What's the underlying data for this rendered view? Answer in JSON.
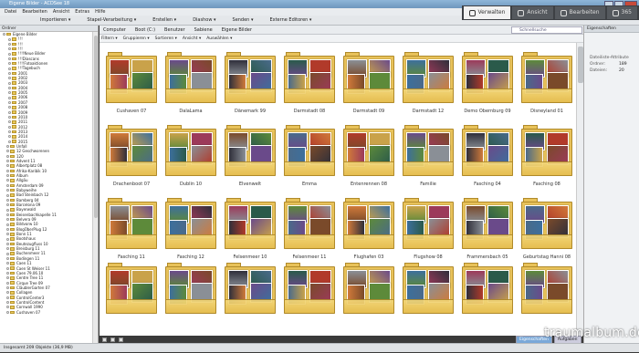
{
  "window": {
    "title": "Eigene Bilder - ACDSee 18"
  },
  "menu": [
    "Datei",
    "Bearbeiten",
    "Ansicht",
    "Extras",
    "Hilfe"
  ],
  "toolbar": [
    "Importieren ▾",
    "Stapel-Verarbeitung ▾",
    "Erstellen ▾",
    "Diashow ▾",
    "Senden ▾",
    "Externe Editoren ▾"
  ],
  "modes": [
    {
      "label": "Verwalten",
      "active": true
    },
    {
      "label": "Ansicht",
      "active": false
    },
    {
      "label": "Bearbeiten",
      "active": false
    },
    {
      "label": "365",
      "active": false
    }
  ],
  "left_panel": {
    "title": "Ordner"
  },
  "tree": [
    "Eigene Bilder",
    "!!!",
    "!!!",
    "!!!",
    "!!!!Neue Bilder",
    "!!!Diascans",
    "!!!!Fotoaktionen",
    "!!!Tagebuch",
    "2001",
    "2002",
    "2003",
    "2004",
    "2005",
    "2006",
    "2007",
    "2008",
    "2009",
    "2010",
    "2011",
    "2012",
    "2013",
    "2014",
    "2015",
    "Unfall",
    "12 Geschworenen",
    "120",
    "Advent 11",
    "Albertplatz 08",
    "Afrika-Karibik 10",
    "Album",
    "Allgäu",
    "Amsterdam 09",
    "Babyweihe",
    "Bad Steinbach 12",
    "Bamberg 04",
    "Barcelona 09",
    "Bayerwald",
    "Beisenbachkapelle 11",
    "Belvera 09",
    "Bildvorw 10",
    "BlogÜberPlug 12",
    "Bonn 11",
    "Bootshaus",
    "Beutezugfluss 10",
    "Breisburg 11",
    "Buchenmeer 11",
    "Bodingen 11",
    "Caen 11",
    "Caen St Weiser 11",
    "Caen 79.06.10",
    "Centre Tree 11",
    "Cirque Tree 09",
    "CläublerGarten 07",
    "Collagen",
    "ControlCenter3",
    "ControlContent",
    "Cornwall 1990",
    "Cushaven 07"
  ],
  "path": [
    "Computer",
    "Boot (C:)",
    "Benutzer",
    "Sabiene",
    "Eigene Bilder"
  ],
  "quicksearch": {
    "placeholder": "Schnellsuche"
  },
  "filters": [
    "Filtern ▾",
    "Gruppieren ▾",
    "Sortieren ▾",
    "Ansicht ▾",
    "Auswählen ▾"
  ],
  "folders": [
    {
      "name": "Cushaven 07"
    },
    {
      "name": "DalaLama"
    },
    {
      "name": "Dänemark 99"
    },
    {
      "name": "Darmstadt 08"
    },
    {
      "name": "Darmstadt 09"
    },
    {
      "name": "Darmstadt 12"
    },
    {
      "name": "Demo Obernburg 09"
    },
    {
      "name": "Disneyland 01"
    },
    {
      "name": "Drachenboot 07"
    },
    {
      "name": "Dublin 10"
    },
    {
      "name": "Elvenwelt"
    },
    {
      "name": "Emma"
    },
    {
      "name": "Entenrennen 08"
    },
    {
      "name": "Familie"
    },
    {
      "name": "Fasching 04"
    },
    {
      "name": "Fasching 08"
    },
    {
      "name": "Fasching 11"
    },
    {
      "name": "Fasching 12"
    },
    {
      "name": "Felsenmeer 10"
    },
    {
      "name": "Felsenmeer 11"
    },
    {
      "name": "Flughafen 03"
    },
    {
      "name": "Flugshow 08"
    },
    {
      "name": "Frammersbach 05"
    },
    {
      "name": "Geburtstag Hanni 08"
    },
    {
      "name": ""
    },
    {
      "name": ""
    },
    {
      "name": ""
    },
    {
      "name": ""
    },
    {
      "name": ""
    },
    {
      "name": ""
    },
    {
      "name": ""
    },
    {
      "name": ""
    }
  ],
  "properties": {
    "title": "Eigenschaften",
    "section": "Dateiliste-Attribute",
    "rows": [
      {
        "k": "Ordner:",
        "v": "189"
      },
      {
        "k": "Dateien:",
        "v": "20"
      }
    ]
  },
  "status": {
    "text": "Insgesamt 209 Objekte (36,9 MB)"
  },
  "bottom_tabs": [
    "Eigenschaften",
    "Aufgaben"
  ],
  "watermark": "traumalbum.de"
}
